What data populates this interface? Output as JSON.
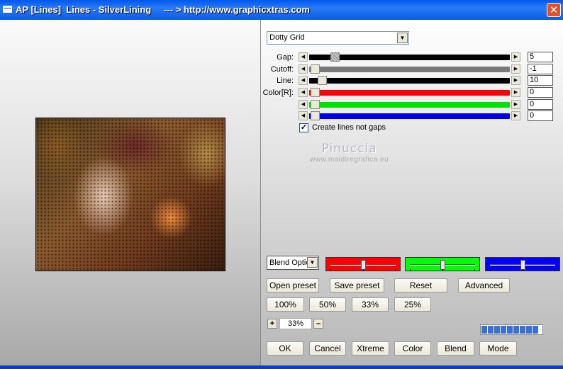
{
  "window": {
    "title": "AP [Lines]  Lines - SilverLining     --- > http://www.graphicxtras.com",
    "close_glyph": "✕"
  },
  "effect_dropdown": {
    "value": "Dotty Grid"
  },
  "sliders": [
    {
      "label": "Gap:",
      "value": "5",
      "color": "#000000"
    },
    {
      "label": "Cutoff:",
      "value": "-1",
      "color": "#7a7a7a"
    },
    {
      "label": "Line:",
      "value": "10",
      "color": "#000000"
    },
    {
      "label": "Color[R]:",
      "value": "0",
      "color": "#ff0000"
    },
    {
      "label": "",
      "value": "0",
      "color": "#00e000"
    },
    {
      "label": "",
      "value": "0",
      "color": "#0000e0"
    }
  ],
  "create_lines_checkbox": {
    "label": "Create lines not gaps",
    "checked": true,
    "mark": "✓"
  },
  "watermark": {
    "name": "Pinuccia",
    "site": "www.maidiregrafica.eu"
  },
  "blend_options": {
    "value": "Blend Optic"
  },
  "channel_sliders": [
    {
      "color": "#ff0000"
    },
    {
      "color": "#00ff00"
    },
    {
      "color": "#0000ff"
    }
  ],
  "buttons_row1": [
    "Open preset",
    "Save preset",
    "Reset",
    "Advanced"
  ],
  "buttons_row2": [
    "100%",
    "50%",
    "33%",
    "25%"
  ],
  "zoom": {
    "plus": "+",
    "value": "33%",
    "minus": "–"
  },
  "progress_segments": 9,
  "buttons_row3": [
    "OK",
    "Cancel",
    "Xtreme",
    "Color",
    "Blend",
    "Mode"
  ]
}
